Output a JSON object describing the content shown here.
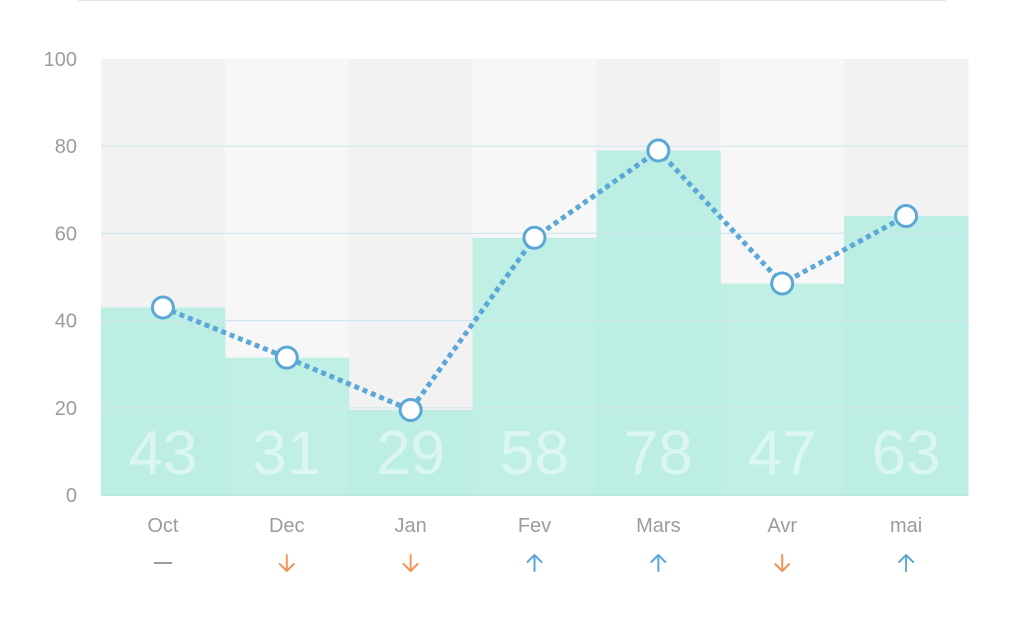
{
  "chart_data": {
    "type": "bar",
    "title": "",
    "xlabel": "",
    "ylabel": "",
    "ylim": [
      0,
      100
    ],
    "y_ticks": [
      "0",
      "20",
      "40",
      "60",
      "80",
      "100"
    ],
    "categories": [
      "Oct",
      "Dec",
      "Jan",
      "Fev",
      "Mars",
      "Avr",
      "mai"
    ],
    "values": [
      43,
      31,
      29,
      58,
      78,
      47,
      63
    ],
    "bar_heights": [
      43,
      31.5,
      19.5,
      59,
      79,
      48.5,
      64
    ],
    "line_values": [
      43,
      31.5,
      19.5,
      59,
      79,
      48.5,
      64
    ],
    "trends": [
      "none",
      "down",
      "down",
      "up",
      "up",
      "down",
      "up"
    ],
    "trend_icons": [
      "dash-icon",
      "arrow-down-icon",
      "arrow-down-icon",
      "arrow-up-icon",
      "arrow-up-icon",
      "arrow-down-icon",
      "arrow-up-icon"
    ],
    "grid": true,
    "legend": "none",
    "colors": {
      "bar": "#b9ede1",
      "line": "#5aa7d8",
      "background_light": "#f7f7f7",
      "background_dark": "#f2f2f2",
      "arrow_up": "#5aa7d8",
      "arrow_down": "#f0955a",
      "dash": "#9c9c9c"
    }
  }
}
